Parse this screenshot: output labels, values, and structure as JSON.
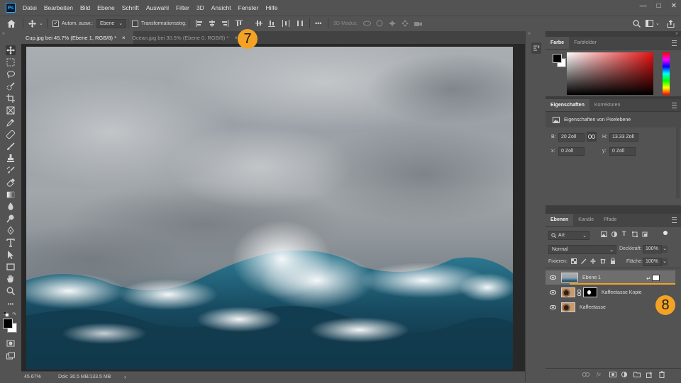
{
  "app": {
    "logo": "Ps"
  },
  "menu": [
    "Datei",
    "Bearbeiten",
    "Bild",
    "Ebene",
    "Schrift",
    "Auswahl",
    "Filter",
    "3D",
    "Ansicht",
    "Fenster",
    "Hilfe"
  ],
  "options": {
    "auto_select_label": "Autom. ausw.:",
    "auto_select_checked": true,
    "auto_select_target": "Ebene",
    "transform_label": "Transformationsstrg.",
    "more": "•••",
    "mode_3d_label": "3D-Modus:"
  },
  "tabs": [
    {
      "label": "Cup.jpg bei 45.7% (Ebene 1, RGB/8) *",
      "active": true
    },
    {
      "label": "Ocean.jpg bei 30.5% (Ebene 0, RGB/8) *",
      "active": false
    }
  ],
  "tab_close": "×",
  "status": {
    "zoom": "45.67%",
    "doc": "Dok: 30.5 MB/133.5 MB",
    "arrow": "›"
  },
  "panels": {
    "color": {
      "tabs": [
        "Farbe",
        "Farbfelder"
      ]
    },
    "properties": {
      "tabs": [
        "Eigenschaften",
        "Korrekturen"
      ],
      "title": "Eigenschaften von Pixelebene",
      "w_label": "B:",
      "w_value": "20 Zoll",
      "h_label": "H:",
      "h_value": "13.33 Zoll",
      "x_label": "x:",
      "x_value": "0 Zoll",
      "y_label": "y:",
      "y_value": "0 Zoll"
    },
    "layers": {
      "tabs": [
        "Ebenen",
        "Kanäle",
        "Pfade"
      ],
      "filter_kind": "Art",
      "blend_mode": "Normal",
      "opacity_label": "Deckkraft:",
      "opacity_value": "100%",
      "lock_label": "Fixieren:",
      "fill_label": "Fläche:",
      "fill_value": "100%",
      "items": [
        {
          "name": "Ebene 1",
          "selected": true
        },
        {
          "name": "Kaffeetasse Kopie",
          "selected": false
        },
        {
          "name": "Kaffeetasse",
          "selected": false
        }
      ]
    }
  },
  "callouts": [
    "7",
    "8"
  ],
  "colors": {
    "ui_bg": "#535353",
    "panel_tab": "#454545",
    "selected_layer": "#6e6e6e",
    "callout": "#f3a224",
    "foreground": "#000000",
    "background": "#ffffff"
  }
}
